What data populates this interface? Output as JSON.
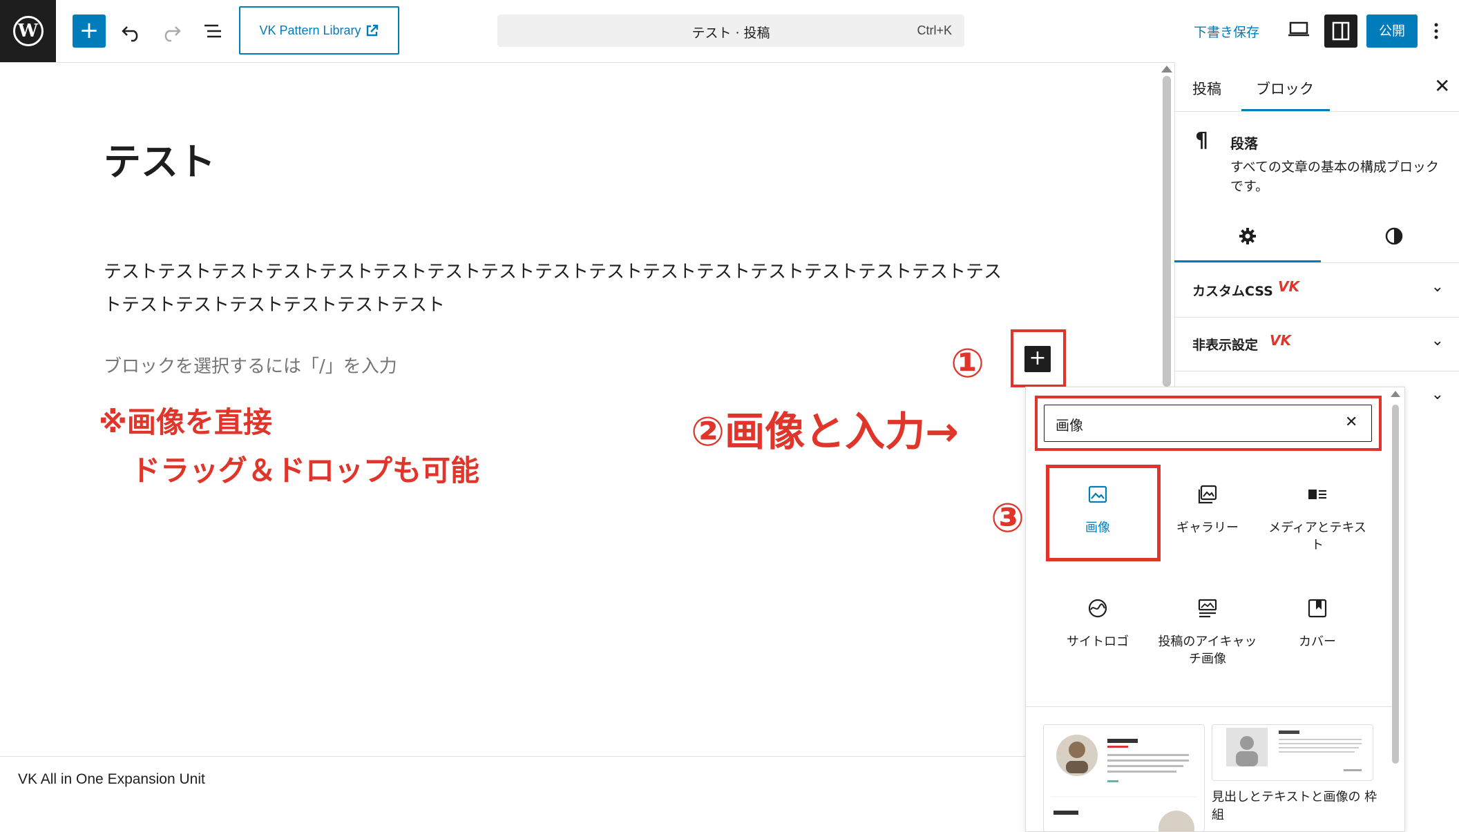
{
  "toolbar": {
    "vk_pattern_library": "VK Pattern Library",
    "command_title": "テスト · 投稿",
    "command_shortcut": "Ctrl+K",
    "save_draft": "下書き保存",
    "publish": "公開",
    "icons": [
      "wordpress-logo",
      "plus",
      "undo",
      "redo",
      "document-overview",
      "external-link",
      "desktop-preview",
      "settings-sidebar",
      "more-vertical"
    ]
  },
  "editor": {
    "post_title": "テスト",
    "paragraph_line1": "テストテストテストテストテストテストテストテストテストテストテストテストテストテストテストテストテス",
    "paragraph_line2": "トテストテストテストテストテストテスト",
    "placeholder": "ブロックを選択するには「/」を入力"
  },
  "annotations": {
    "note_line1": "※画像を直接",
    "note_line2": "ドラッグ＆ドロップも可能",
    "step1": "①",
    "step2": "②画像と入力→",
    "step3": "③",
    "color": "#e0352b"
  },
  "footer": {
    "text": "VK All in One Expansion Unit"
  },
  "sidebar": {
    "tab_post": "投稿",
    "tab_block": "ブロック",
    "block_icon": "¶",
    "block_name": "段落",
    "block_description": "すべての文章の基本の構成ブロックです。",
    "panels": [
      {
        "label": "カスタムCSS",
        "badge": "VK"
      },
      {
        "label": "非表示設定",
        "badge": "VK"
      },
      {
        "label": "",
        "badge": ""
      }
    ]
  },
  "inserter": {
    "search_value": "画像",
    "blocks": [
      {
        "label": "画像",
        "icon": "image-icon"
      },
      {
        "label": "ギャラリー",
        "icon": "gallery-icon"
      },
      {
        "label": "メディアとテキスト",
        "icon": "media-text-icon"
      },
      {
        "label": "サイトロゴ",
        "icon": "site-logo-icon"
      },
      {
        "label": "投稿のアイキャッチ画像",
        "icon": "featured-image-icon"
      },
      {
        "label": "カバー",
        "icon": "cover-icon"
      }
    ],
    "patterns": [
      {
        "title": ""
      },
      {
        "title": "見出しとテキストと画像の 枠組"
      }
    ]
  },
  "colors": {
    "accent": "#007cba",
    "dark": "#1e1e1e",
    "highlight": "#e0352b"
  }
}
